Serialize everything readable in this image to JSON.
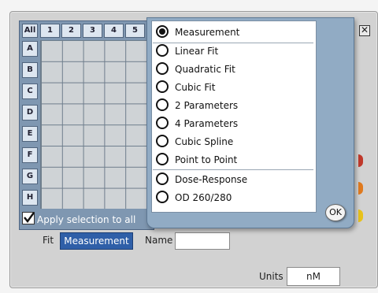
{
  "plate": {
    "all_label": "All",
    "columns": [
      "1",
      "2",
      "3",
      "4",
      "5"
    ],
    "rows": [
      "A",
      "B",
      "C",
      "D",
      "E",
      "F",
      "G",
      "H"
    ],
    "apply_label": "Apply selection to all",
    "apply_checked": true
  },
  "menu": {
    "options": [
      {
        "label": "Measurement",
        "selected": true
      },
      {
        "label": "Linear Fit",
        "selected": false
      },
      {
        "label": "Quadratic Fit",
        "selected": false
      },
      {
        "label": "Cubic Fit",
        "selected": false
      },
      {
        "label": "2 Parameters",
        "selected": false
      },
      {
        "label": "4 Parameters",
        "selected": false
      },
      {
        "label": "Cubic Spline",
        "selected": false
      },
      {
        "label": "Point to Point",
        "selected": false
      },
      {
        "label": "Dose-Response",
        "selected": false
      },
      {
        "label": "OD 260/280",
        "selected": false
      }
    ],
    "ok_label": "OK"
  },
  "form": {
    "fit_label": "Fit",
    "fit_value": "Measurement",
    "name_label": "Name",
    "name_value": "",
    "units_label": "Units",
    "units_value": "nM"
  },
  "window": {
    "close_icon": "close-icon",
    "close_glyph": "✕"
  },
  "colors": {
    "accent_blue": "#2f5fa8",
    "popup_blue": "#91abc4",
    "tab_red": "#c0392b",
    "tab_orange": "#e07a1f",
    "tab_yellow": "#e8c21a"
  }
}
